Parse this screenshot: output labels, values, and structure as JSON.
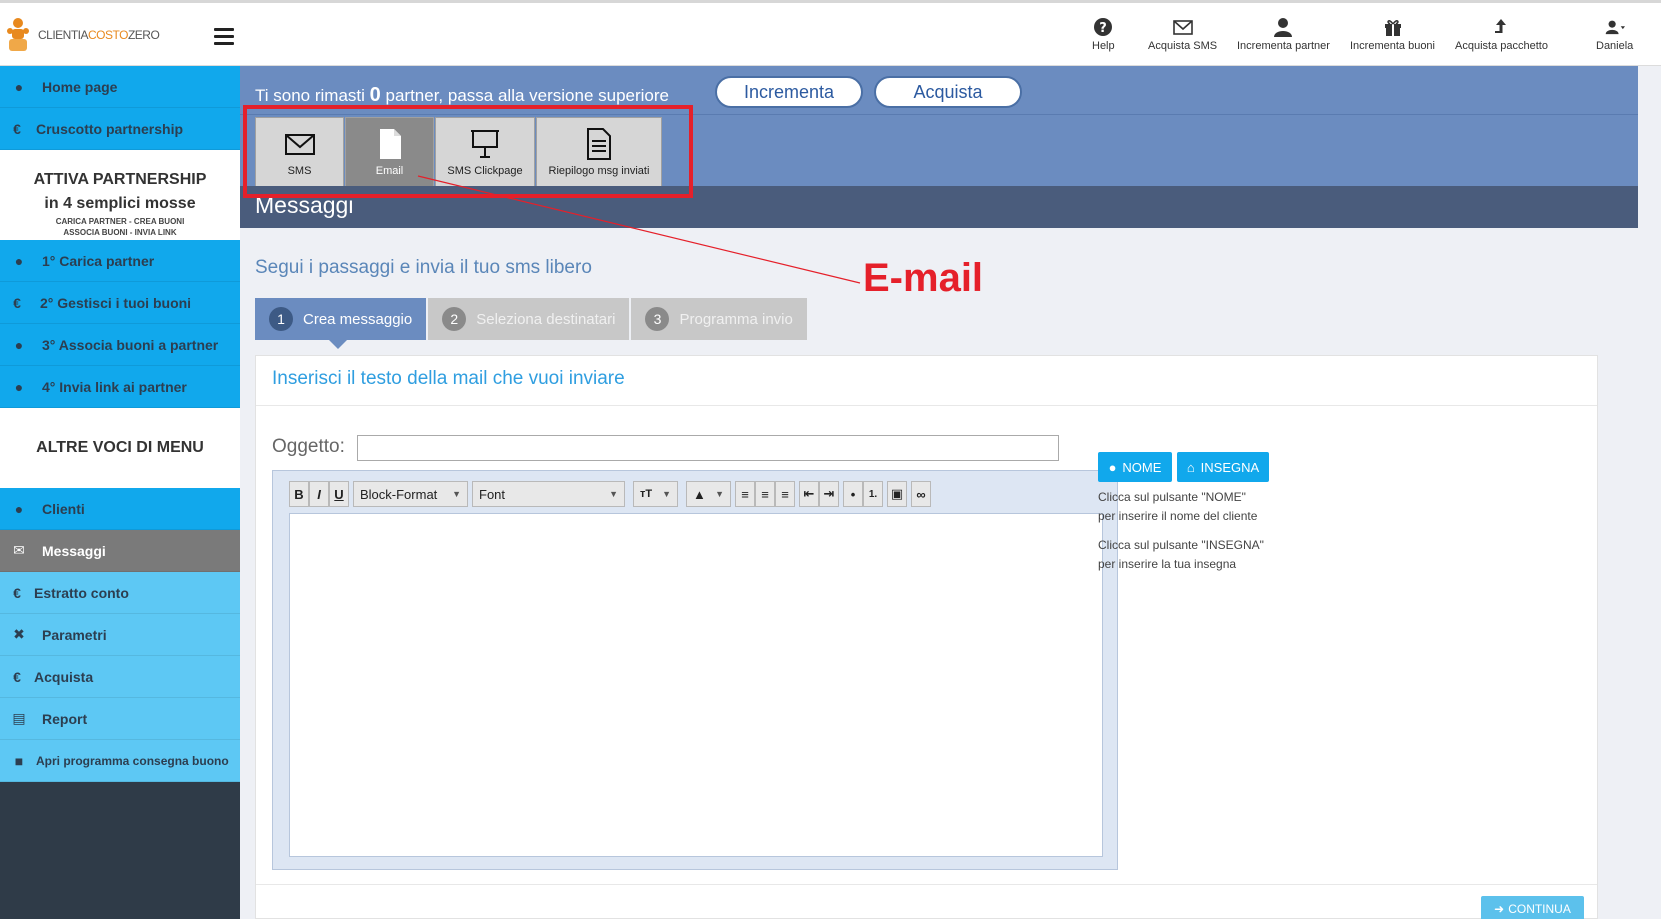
{
  "app": {
    "logo_text_1": "CLIENTIA",
    "logo_text_2": "COSTO",
    "logo_text_3": "ZERO"
  },
  "header": {
    "items": [
      {
        "label": "Help",
        "icon": "help-icon"
      },
      {
        "label": "Acquista SMS",
        "icon": "envelope-icon"
      },
      {
        "label": "Incrementa partner",
        "icon": "user-icon"
      },
      {
        "label": "Incrementa buoni",
        "icon": "gift-icon"
      },
      {
        "label": "Acquista pacchetto",
        "icon": "arrow-up-icon"
      },
      {
        "label": "Daniela",
        "icon": "user-icon"
      }
    ]
  },
  "sidebar": {
    "home": "Home page",
    "cruscotto": "Cruscotto partnership",
    "promo_title_1": "ATTIVA PARTNERSHIP",
    "promo_title_2": "in 4 semplici mosse",
    "promo_sub_1": "CARICA PARTNER - CREA BUONI",
    "promo_sub_2": "ASSOCIA BUONI - INVIA LINK",
    "step1": "1°  Carica partner",
    "step2": "2°  Gestisci i tuoi buoni",
    "step3": "3°  Associa buoni a partner",
    "step4": "4°  Invia link ai partner",
    "section": "ALTRE VOCI DI MENU",
    "clienti": "Clienti",
    "messaggi": "Messaggi",
    "estratto": "Estratto conto",
    "parametri": "Parametri",
    "acquista": "Acquista",
    "report": "Report",
    "apri": "Apri programma consegna buono",
    "euro_symbol": "€"
  },
  "banner": {
    "text_before": "Ti sono rimasti",
    "count": "0",
    "text_after": "partner, passa alla versione superiore",
    "incrementa": "Incrementa",
    "acquista": "Acquista"
  },
  "msgtabs": {
    "sms": "SMS",
    "email": "Email",
    "clickpage": "SMS Clickpage",
    "riepilogo": "Riepilogo msg inviati"
  },
  "page_title": "Messaggi",
  "annotation": "E-mail",
  "subtitle": "Segui i passaggi e invia il tuo sms libero",
  "steps": [
    {
      "num": "1",
      "label": "Crea messaggio"
    },
    {
      "num": "2",
      "label": "Seleziona destinatari"
    },
    {
      "num": "3",
      "label": "Programma invio"
    }
  ],
  "card": {
    "title": "Inserisci il testo della mail che vuoi inviare",
    "oggetto_label": "Oggetto:",
    "oggetto_value": "",
    "toolbar": {
      "bold": "B",
      "italic": "I",
      "underline": "U",
      "block_format": "Block-Format",
      "font": "Font",
      "size": "ᴛT"
    },
    "nome_button": "NOME",
    "insegna_button": "INSEGNA",
    "help_nome_1": "Clicca  sul  pulsante  \"NOME\"",
    "help_nome_2": "per inserire il nome del cliente",
    "help_insegna_1": "Clicca sul pulsante \"INSEGNA\"",
    "help_insegna_2": "per inserire la tua insegna",
    "continua": "CONTINUA"
  },
  "colors": {
    "accent": "#11a8ec",
    "banner": "#6b8cc0",
    "title_bar": "#4a5c7c",
    "annotation": "#e5202a"
  }
}
